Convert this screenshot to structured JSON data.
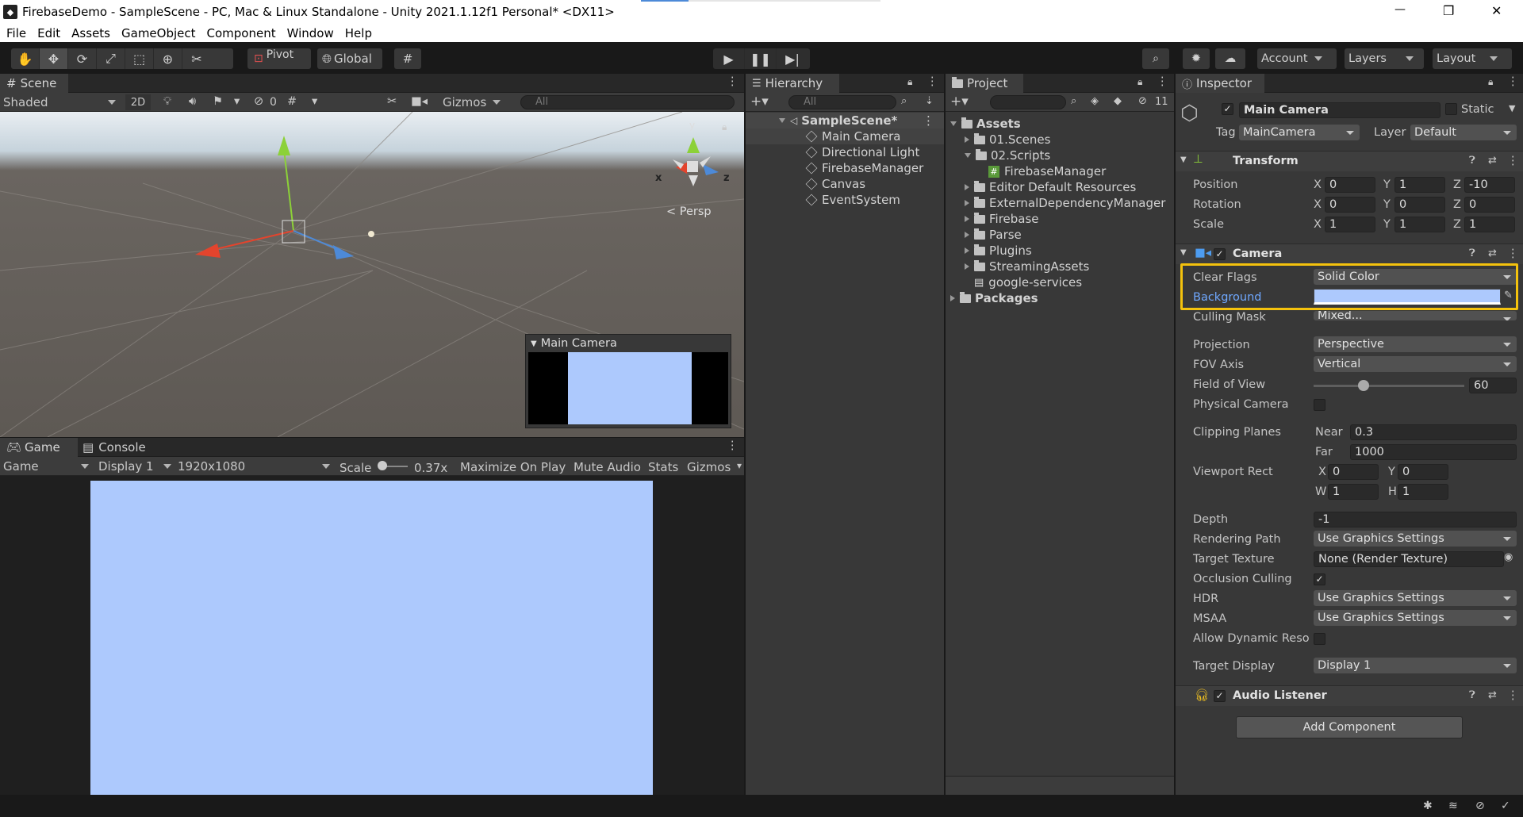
{
  "window": {
    "title": "FirebaseDemo - SampleScene - PC, Mac & Linux Standalone - Unity 2021.1.12f1 Personal* <DX11>",
    "minimize": "—",
    "maximize": "❐",
    "close": "✕"
  },
  "menu": [
    "File",
    "Edit",
    "Assets",
    "GameObject",
    "Component",
    "Window",
    "Help"
  ],
  "toolbar": {
    "pivot": "Pivot",
    "global": "Global",
    "account": "Account",
    "layers": "Layers",
    "layout": "Layout"
  },
  "scene": {
    "tab": "Scene",
    "shading": "Shaded",
    "mode_2d": "2D",
    "hidden_count": "0",
    "gizmos": "Gizmos",
    "search_placeholder": "All",
    "persp": "Persp",
    "gizmo_axes": {
      "x": "x",
      "y": "y",
      "z": "z"
    },
    "camera_preview_title": "Main Camera"
  },
  "game": {
    "tabs": [
      "Game",
      "Console"
    ],
    "mode": "Game",
    "display": "Display 1",
    "resolution": "1920x1080",
    "scale_label": "Scale",
    "scale_value": "0.37x",
    "buttons": [
      "Maximize On Play",
      "Mute Audio",
      "Stats",
      "Gizmos"
    ],
    "background_color": "#adc9fd"
  },
  "hierarchy": {
    "tab": "Hierarchy",
    "search_placeholder": "All",
    "scene": "SampleScene*",
    "items": [
      "Main Camera",
      "Directional Light",
      "FirebaseManager",
      "Canvas",
      "EventSystem"
    ]
  },
  "project": {
    "tab": "Project",
    "hidden_count": "11",
    "root": "Assets",
    "items": [
      {
        "name": "01.Scenes",
        "type": "folder",
        "depth": 1,
        "arrow": "right"
      },
      {
        "name": "02.Scripts",
        "type": "folder",
        "depth": 1,
        "arrow": "down"
      },
      {
        "name": "FirebaseManager",
        "type": "script",
        "depth": 2,
        "arrow": ""
      },
      {
        "name": "Editor Default Resources",
        "type": "folder",
        "depth": 1,
        "arrow": "right"
      },
      {
        "name": "ExternalDependencyManager",
        "type": "folder",
        "depth": 1,
        "arrow": "right"
      },
      {
        "name": "Firebase",
        "type": "folder",
        "depth": 1,
        "arrow": "right"
      },
      {
        "name": "Parse",
        "type": "folder",
        "depth": 1,
        "arrow": "right"
      },
      {
        "name": "Plugins",
        "type": "folder",
        "depth": 1,
        "arrow": "right"
      },
      {
        "name": "StreamingAssets",
        "type": "folder",
        "depth": 1,
        "arrow": "right"
      },
      {
        "name": "google-services",
        "type": "file",
        "depth": 1,
        "arrow": ""
      }
    ],
    "packages": "Packages"
  },
  "inspector": {
    "tab": "Inspector",
    "object_name": "Main Camera",
    "static": "Static",
    "tag_label": "Tag",
    "tag": "MainCamera",
    "layer_label": "Layer",
    "layer": "Default",
    "transform": {
      "title": "Transform",
      "position_label": "Position",
      "position": {
        "x": "0",
        "y": "1",
        "z": "-10"
      },
      "rotation_label": "Rotation",
      "rotation": {
        "x": "0",
        "y": "0",
        "z": "0"
      },
      "scale_label": "Scale",
      "scale": {
        "x": "1",
        "y": "1",
        "z": "1"
      },
      "axes": {
        "x": "X",
        "y": "Y",
        "z": "Z"
      }
    },
    "camera": {
      "title": "Camera",
      "clear_flags_label": "Clear Flags",
      "clear_flags": "Solid Color",
      "background_label": "Background",
      "background_color": "#adc9fd",
      "culling_mask_label": "Culling Mask",
      "culling_mask": "Mixed...",
      "projection_label": "Projection",
      "projection": "Perspective",
      "fov_axis_label": "FOV Axis",
      "fov_axis": "Vertical",
      "fov_label": "Field of View",
      "fov": "60",
      "fov_slider_fraction": 0.33,
      "physical_label": "Physical Camera",
      "clipping_label": "Clipping Planes",
      "near_label": "Near",
      "near": "0.3",
      "far_label": "Far",
      "far": "1000",
      "viewport_label": "Viewport Rect",
      "vp": {
        "x": "0",
        "y": "0",
        "w": "1",
        "h": "1"
      },
      "vp_axes": {
        "x": "X",
        "y": "Y",
        "w": "W",
        "h": "H"
      },
      "depth_label": "Depth",
      "depth": "-1",
      "rendering_path_label": "Rendering Path",
      "rendering_path": "Use Graphics Settings",
      "target_texture_label": "Target Texture",
      "target_texture": "None (Render Texture)",
      "occlusion_label": "Occlusion Culling",
      "hdr_label": "HDR",
      "hdr": "Use Graphics Settings",
      "msaa_label": "MSAA",
      "msaa": "Use Graphics Settings",
      "dynamic_res_label": "Allow Dynamic Reso",
      "target_display_label": "Target Display",
      "target_display": "Display 1"
    },
    "audio_listener": {
      "title": "Audio Listener"
    },
    "add_component": "Add Component",
    "highlight_color": "#f4c20d"
  },
  "colors": {
    "scene_sky": "#d6dfe6",
    "ground": "#5e5954",
    "accent_blue": "#4d8ad8"
  }
}
